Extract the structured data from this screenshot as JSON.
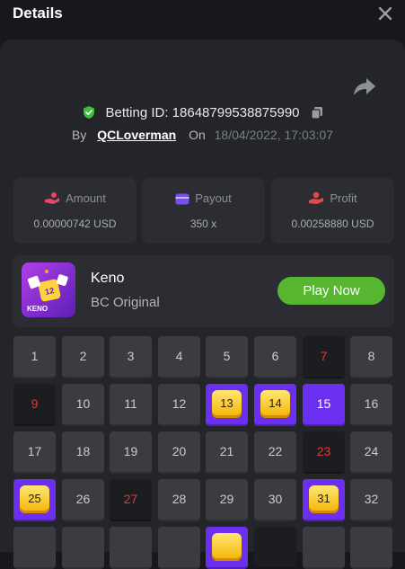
{
  "header": {
    "title": "Details"
  },
  "bet": {
    "id_text": "Betting ID: 18648799538875990",
    "by_label": "By",
    "user": "QCLoverman",
    "on_label": "On",
    "date": "18/04/2022, 17:03:07"
  },
  "stats": [
    {
      "label": "Amount",
      "value": "0.00000742 USD",
      "icon": "amount-icon",
      "color": "#e8476c"
    },
    {
      "label": "Payout",
      "value": "350 x",
      "icon": "payout-icon",
      "color": "#7b4df0"
    },
    {
      "label": "Profit",
      "value": "0.00258880 USD",
      "icon": "profit-icon",
      "color": "#e84848"
    }
  ],
  "game": {
    "name": "Keno",
    "subtitle": "BC Original",
    "thumb_text": "KENO",
    "play_label": "Play Now",
    "play_color": "#57b630"
  },
  "grid": {
    "cells": [
      {
        "n": "1",
        "s": "normal"
      },
      {
        "n": "2",
        "s": "normal"
      },
      {
        "n": "3",
        "s": "normal"
      },
      {
        "n": "4",
        "s": "normal"
      },
      {
        "n": "5",
        "s": "normal"
      },
      {
        "n": "6",
        "s": "normal"
      },
      {
        "n": "7",
        "s": "hit"
      },
      {
        "n": "8",
        "s": "normal"
      },
      {
        "n": "9",
        "s": "hit"
      },
      {
        "n": "10",
        "s": "normal"
      },
      {
        "n": "11",
        "s": "normal"
      },
      {
        "n": "12",
        "s": "normal"
      },
      {
        "n": "13",
        "s": "match"
      },
      {
        "n": "14",
        "s": "match"
      },
      {
        "n": "15",
        "s": "pick"
      },
      {
        "n": "16",
        "s": "normal"
      },
      {
        "n": "17",
        "s": "normal"
      },
      {
        "n": "18",
        "s": "normal"
      },
      {
        "n": "19",
        "s": "normal"
      },
      {
        "n": "20",
        "s": "normal"
      },
      {
        "n": "21",
        "s": "normal"
      },
      {
        "n": "22",
        "s": "normal"
      },
      {
        "n": "23",
        "s": "hit"
      },
      {
        "n": "24",
        "s": "normal"
      },
      {
        "n": "25",
        "s": "match"
      },
      {
        "n": "26",
        "s": "normal"
      },
      {
        "n": "27",
        "s": "hit"
      },
      {
        "n": "28",
        "s": "normal"
      },
      {
        "n": "29",
        "s": "normal"
      },
      {
        "n": "30",
        "s": "normal"
      },
      {
        "n": "31",
        "s": "match"
      },
      {
        "n": "32",
        "s": "normal"
      },
      {
        "n": "",
        "s": "normal"
      },
      {
        "n": "",
        "s": "normal"
      },
      {
        "n": "",
        "s": "normal"
      },
      {
        "n": "",
        "s": "normal"
      },
      {
        "n": "",
        "s": "match"
      },
      {
        "n": "",
        "s": "hit"
      },
      {
        "n": "",
        "s": "normal"
      },
      {
        "n": "",
        "s": "normal"
      }
    ]
  }
}
